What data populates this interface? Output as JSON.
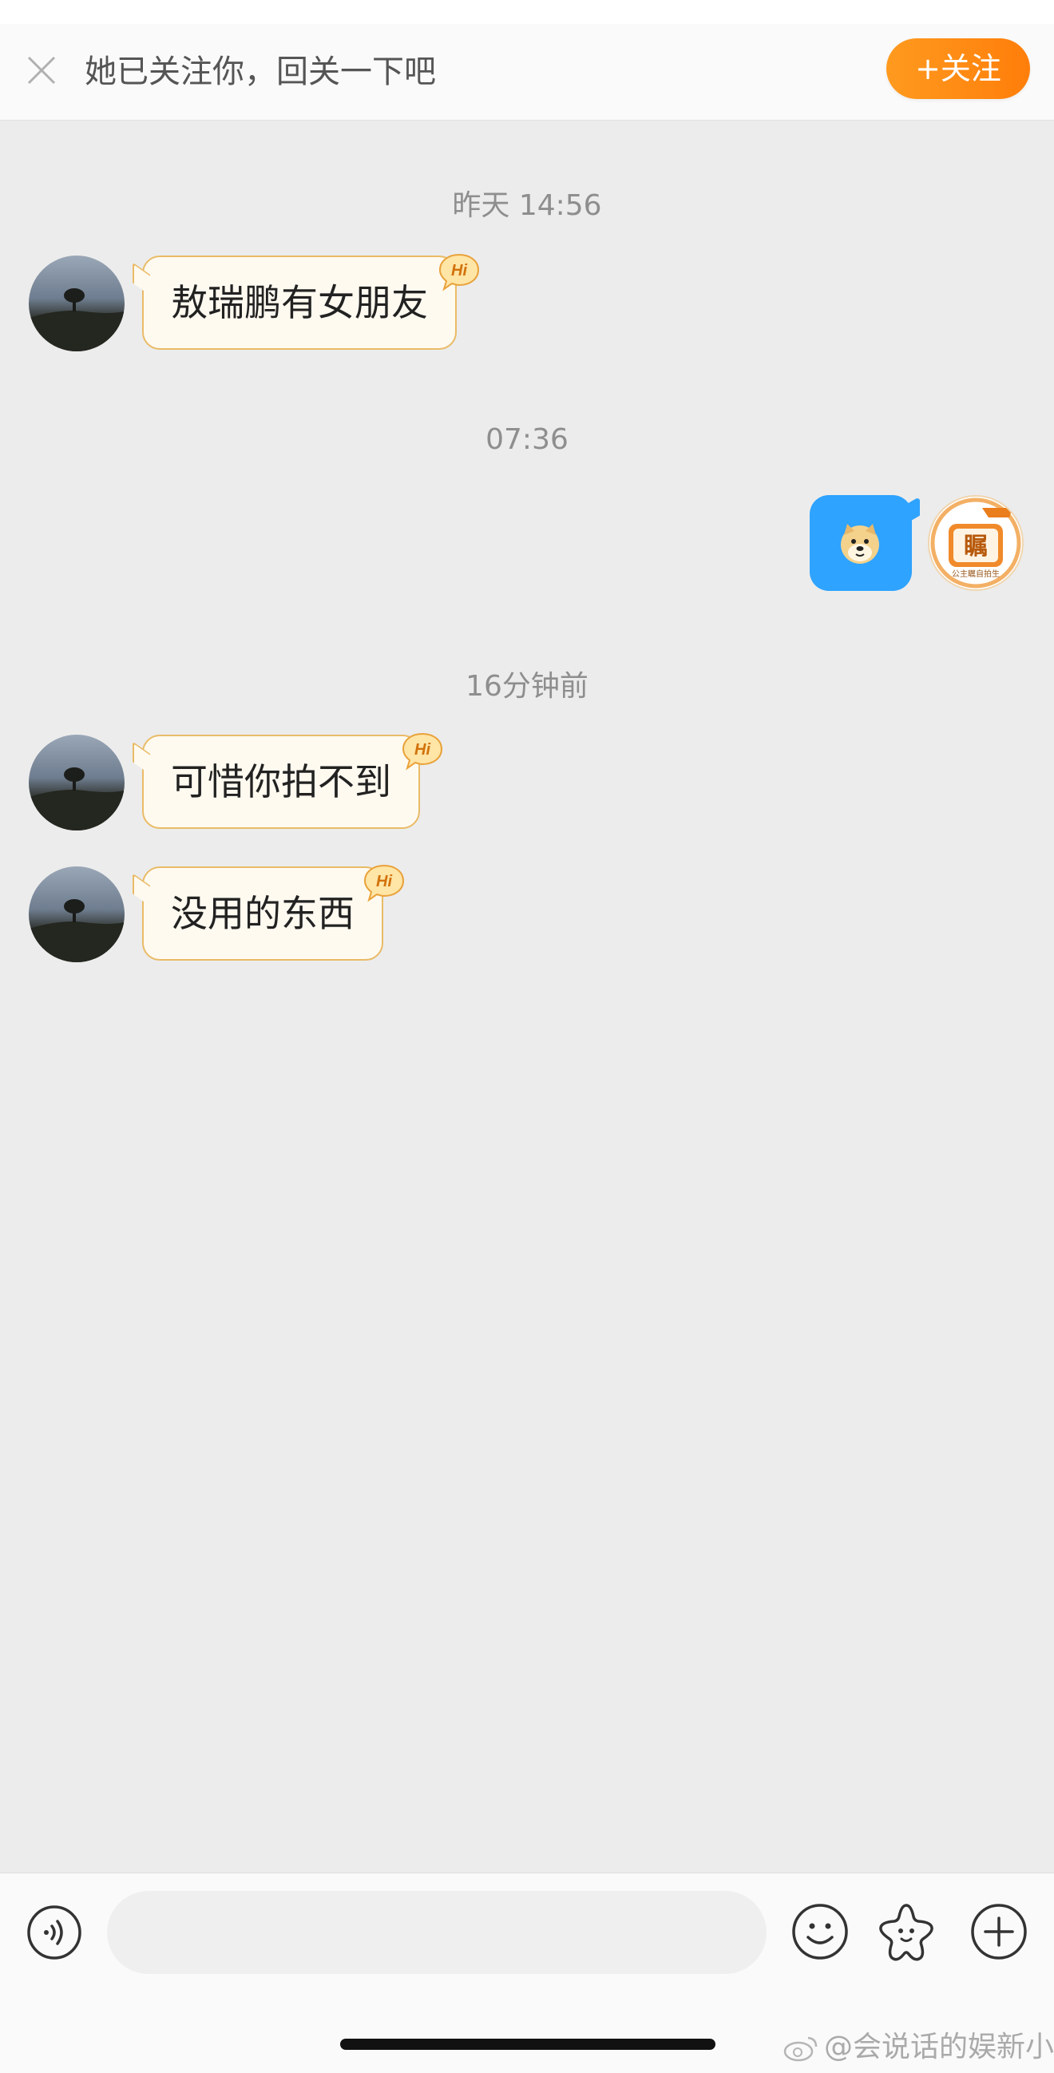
{
  "follow_bar": {
    "prompt": "她已关注你，回关一下吧",
    "follow_button": "+关注",
    "accent": "#ff8a12"
  },
  "conversation": {
    "timestamps": [
      "昨天 14:56",
      "07:36",
      "16分钟前"
    ],
    "received": [
      {
        "text": "敖瑞鹏有女朋友",
        "badge": "Hi"
      },
      {
        "text": "可惜你拍不到",
        "badge": "Hi"
      },
      {
        "text": "没用的东西",
        "badge": "Hi"
      }
    ],
    "sent": [
      {
        "type": "sticker",
        "icon": "doge-emoji-icon",
        "bubble_color": "#2ea3ff"
      }
    ],
    "my_avatar_text": "公主瞩自拍生"
  },
  "input_bar": {
    "placeholder": "",
    "icons": [
      "voice-icon",
      "emoji-smile-icon",
      "sticker-star-icon",
      "plus-circle-icon"
    ]
  },
  "watermark": {
    "text": "@会说话的娱新小弟"
  }
}
